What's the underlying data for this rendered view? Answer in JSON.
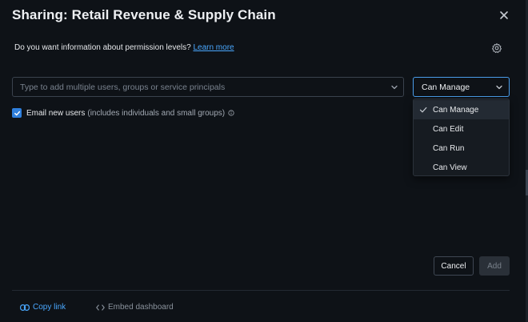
{
  "dialog": {
    "title": "Sharing: Retail Revenue & Supply Chain"
  },
  "info": {
    "question": "Do you want information about permission levels?",
    "learn_more": "Learn more"
  },
  "user_input": {
    "placeholder": "Type to add multiple users, groups or service principals"
  },
  "permission": {
    "selected": "Can Manage",
    "options": [
      {
        "label": "Can Manage",
        "selected": true
      },
      {
        "label": "Can Edit",
        "selected": false
      },
      {
        "label": "Can Run",
        "selected": false
      },
      {
        "label": "Can View",
        "selected": false
      }
    ]
  },
  "email": {
    "checked": true,
    "label": "Email new users",
    "hint": "(includes individuals and small groups)"
  },
  "actions": {
    "cancel": "Cancel",
    "add": "Add"
  },
  "footer": {
    "copy_link": "Copy link",
    "embed": "Embed dashboard"
  },
  "colors": {
    "background": "#0e1217",
    "accent": "#4aa8ff",
    "checkbox": "#2f7fdc",
    "focus_border": "#4a9dea"
  },
  "icons": [
    "close-icon",
    "gear-icon",
    "chevron-down-icon",
    "check-icon",
    "info-icon",
    "link-icon",
    "code-icon"
  ]
}
